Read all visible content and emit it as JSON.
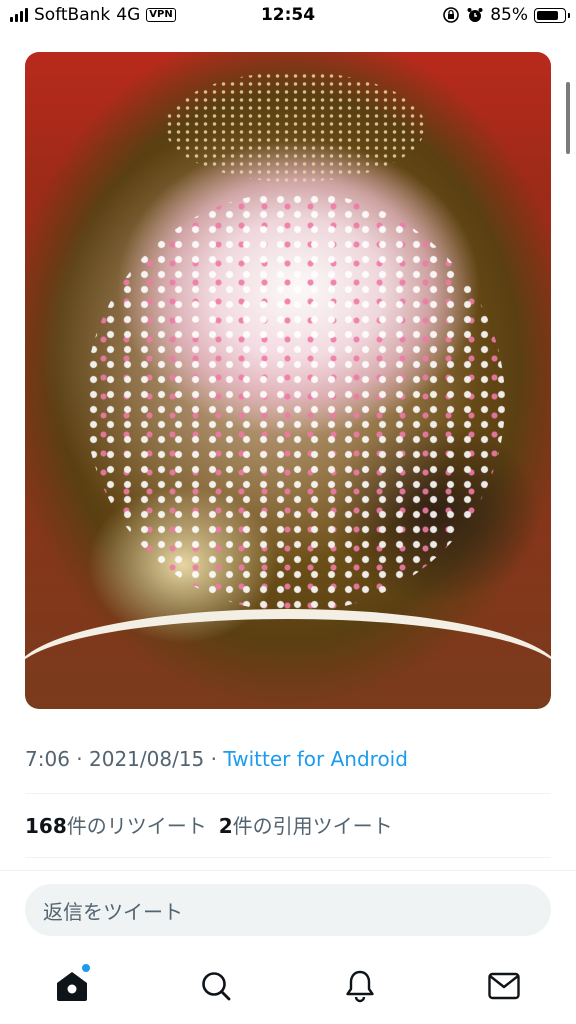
{
  "status_bar": {
    "carrier": "SoftBank",
    "network": "4G",
    "vpn": "VPN",
    "time": "12:54",
    "battery_percent": "85%",
    "battery_level": 0.85
  },
  "tweet": {
    "photo_icon": "food-photo",
    "time": "7:06",
    "date": "2021/08/15",
    "separator": "·",
    "source": "Twitter for Android",
    "retweets_count": "168",
    "retweets_label": "件のリツイート",
    "quotes_count": "2",
    "quotes_label": "件の引用ツイート"
  },
  "reply": {
    "placeholder": "返信をツイート"
  },
  "nav": {
    "items": [
      {
        "name": "home",
        "icon": "home-icon",
        "has_notification_dot": true
      },
      {
        "name": "search",
        "icon": "search-icon"
      },
      {
        "name": "notifications",
        "icon": "bell-icon"
      },
      {
        "name": "messages",
        "icon": "mail-icon"
      }
    ]
  },
  "colors": {
    "accent": "#1d9bf0",
    "text_secondary": "#536471",
    "reply_bg": "#eff3f4"
  }
}
